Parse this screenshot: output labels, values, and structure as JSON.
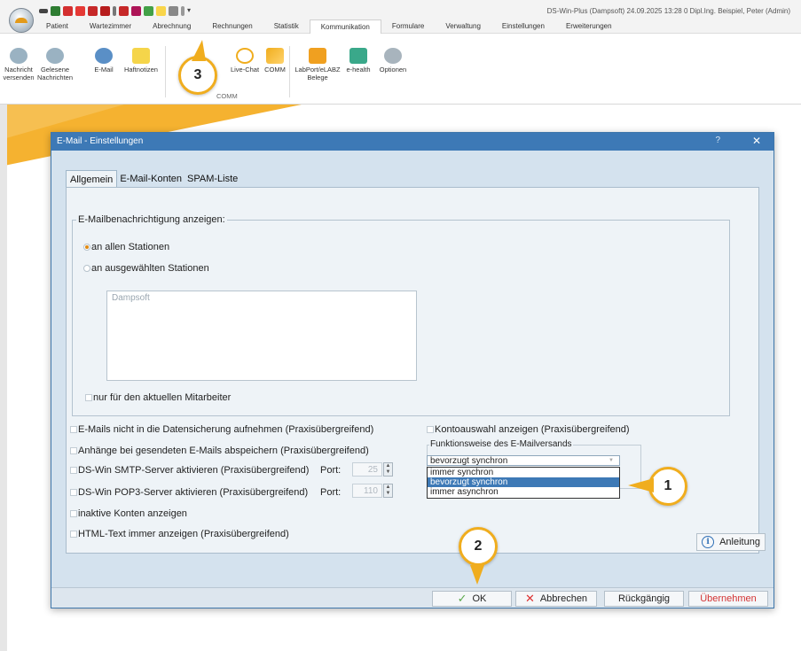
{
  "app": {
    "title": "DS-Win-Plus (Dampsoft)   24.09.2025  13:28  0  Dipl.Ing.  Beispiel, Peter  (Admin)"
  },
  "ribbon": {
    "tabs": [
      "Patient",
      "Wartezimmer",
      "Abrechnung",
      "Rechnungen",
      "Statistik",
      "Kommunikation",
      "Formulare",
      "Verwaltung",
      "Einstellungen",
      "Erweiterungen"
    ],
    "active_tab": "Kommunikation",
    "buttons": {
      "nachricht_versenden": "Nachricht\nversenden",
      "gelesene_nachrichten": "Gelesene\nNachrichten",
      "email": "E-Mail",
      "haftnotizen": "Haftnotizen",
      "livechat": "Live-Chat",
      "comm": "COMM",
      "labport": "LabPort/eLABZ\nBelege",
      "ehealth": "e-health",
      "optionen": "Optionen"
    },
    "group_comm": "COMM"
  },
  "dialog": {
    "title": "E-Mail - Einstellungen",
    "help": "?",
    "close": "✕",
    "tabs": [
      "Allgemein",
      "E-Mail-Konten",
      "SPAM-Liste"
    ],
    "active_tab": "Allgemein",
    "notify_group": "E-Mailbenachrichtigung anzeigen:",
    "radio_all": "an allen Stationen",
    "radio_selected": "an ausgewählten Stationen",
    "stations": [
      "Dampsoft"
    ],
    "only_current": "nur für den aktuellen Mitarbeiter",
    "options": {
      "no_backup": "E-Mails nicht in die Datensicherung aufnehmen (Praxisübergreifend)",
      "save_attachments": "Anhänge bei gesendeten E-Mails abspeichern (Praxisübergreifend)",
      "smtp": "DS-Win SMTP-Server aktivieren (Praxisübergreifend)",
      "pop3": "DS-Win POP3-Server aktivieren (Praxisübergreifend)",
      "inactive_accounts": "inaktive Konten anzeigen",
      "html_text": "HTML-Text immer anzeigen (Praxisübergreifend)",
      "account_select": "Kontoauswahl anzeigen (Praxisübergreifend)"
    },
    "port_label": "Port:",
    "smtp_port": "25",
    "pop3_port": "110",
    "sending_group": "Funktionsweise des E-Mailversands",
    "sending_value": "bevorzugt synchron",
    "sending_options": [
      "immer synchron",
      "bevorzugt synchron",
      "immer asynchron"
    ],
    "sending_selected_index": 1,
    "anleitung": "Anleitung",
    "ok": "OK",
    "abbrechen": "Abbrechen",
    "rueckgaengig": "Rückgängig",
    "uebernehmen": "Übernehmen"
  },
  "callouts": [
    "1",
    "2",
    "3"
  ],
  "colors": {
    "accent_orange": "#f0ad1e",
    "title_blue": "#3d79b6",
    "uebernehmen_red": "#d33333"
  }
}
